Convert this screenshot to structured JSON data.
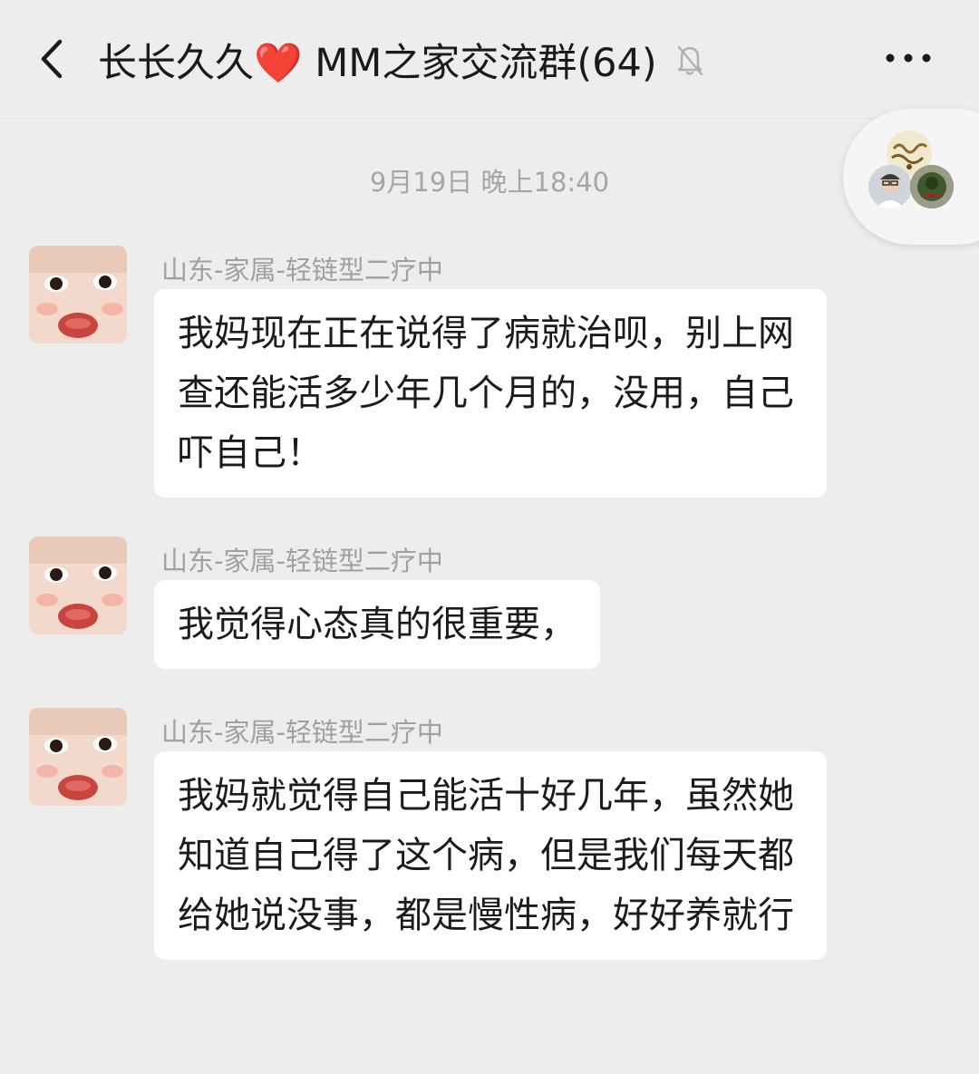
{
  "header": {
    "title": "长长久久❤️ MM之家交流群(64)"
  },
  "chat": {
    "timestamp": "9月19日 晚上18:40",
    "messages": [
      {
        "sender": "山东-家属-轻链型二疗中",
        "text": "我妈现在正在说得了病就治呗，别上网查还能活多少年几个月的，没用，自己吓自己！"
      },
      {
        "sender": "山东-家属-轻链型二疗中",
        "text": "我觉得心态真的很重要，"
      },
      {
        "sender": "山东-家属-轻链型二疗中",
        "text": "我妈就觉得自己能活十好几年，虽然她知道自己得了这个病，但是我们每天都给她说没事，都是慢性病，好好养就行"
      }
    ]
  },
  "colors": {
    "background": "#ededed",
    "bubble": "#ffffff",
    "text": "#1b1b1b",
    "meta_text": "#a6a6a6"
  },
  "icons": {
    "back": "chevron-left-icon",
    "mute": "bell-off-icon",
    "more": "more-dots-icon"
  }
}
